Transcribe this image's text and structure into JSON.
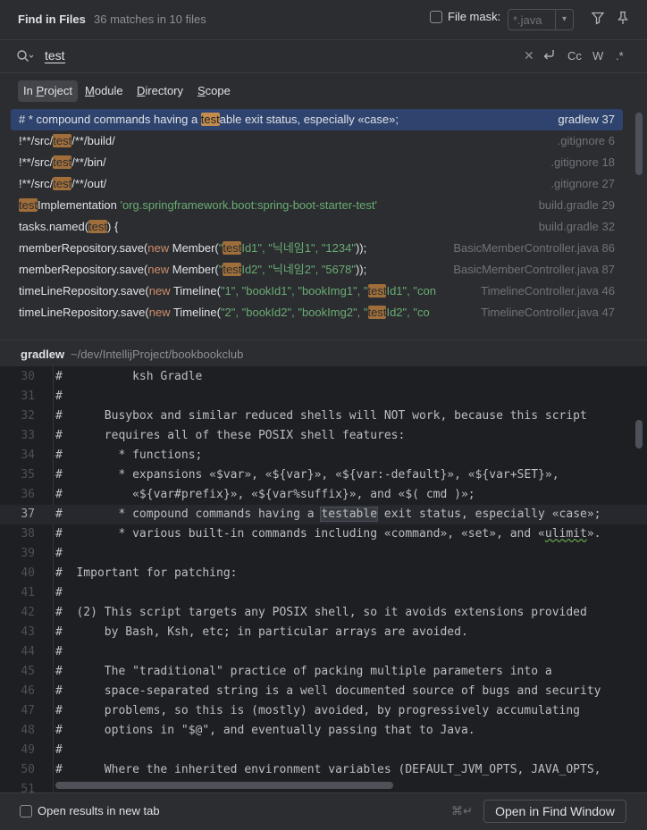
{
  "header": {
    "title": "Find in Files",
    "match_count": "36 matches in 10 files",
    "file_mask_label": "File mask:",
    "file_mask_value": "*.java"
  },
  "search": {
    "query": "test",
    "options": [
      "Cc",
      "W",
      ".*"
    ]
  },
  "scope": {
    "tabs": [
      {
        "prefix": "In ",
        "underline": "P",
        "rest": "roject",
        "active": true
      },
      {
        "prefix": "",
        "underline": "M",
        "rest": "odule"
      },
      {
        "prefix": "",
        "underline": "D",
        "rest": "irectory"
      },
      {
        "prefix": "",
        "underline": "S",
        "rest": "cope"
      }
    ]
  },
  "results": [
    {
      "pre": "#        * compound commands having a ",
      "match": "test",
      "post": "able exit status, especially «case»;",
      "file": "gradlew",
      "line": "37",
      "selected": true
    },
    {
      "pre": "!**/src/",
      "match": "test",
      "post": "/**/build/",
      "file": ".gitignore",
      "line": "6"
    },
    {
      "pre": "!**/src/",
      "match": "test",
      "post": "/**/bin/",
      "file": ".gitignore",
      "line": "18"
    },
    {
      "pre": "!**/src/",
      "match": "test",
      "post": "/**/out/",
      "file": ".gitignore",
      "line": "27"
    },
    {
      "pre": "",
      "match": "test",
      "post": "Implementation ",
      "str": "'org.springframework.boot:spring-boot-starter-test'",
      "file": "build.gradle",
      "line": "29"
    },
    {
      "pre": "tasks.named(",
      "match": "test",
      "post": ") {",
      "file": "build.gradle",
      "line": "32"
    },
    {
      "pre": "memberRepository.save(",
      "kw": "new",
      "pre2": " Member(",
      "strpre": "\"",
      "match": "test",
      "strpost": "Id1\", \"닉네임1\", \"1234\"",
      "post": "));",
      "file": "BasicMemberController.java",
      "line": "86"
    },
    {
      "pre": "memberRepository.save(",
      "kw": "new",
      "pre2": " Member(",
      "strpre": "\"",
      "match": "test",
      "strpost": "Id2\", \"닉네임2\", \"5678\"",
      "post": "));",
      "file": "BasicMemberController.java",
      "line": "87"
    },
    {
      "pre": "timeLineRepository.save(",
      "kw": "new",
      "pre2": " Timeline(",
      "strpre": "\"1\", \"bookId1\", \"bookImg1\", \"",
      "match": "test",
      "strpost": "Id1\", \"con",
      "post": "",
      "file": "TimelineController.java",
      "line": "46"
    },
    {
      "pre": "timeLineRepository.save(",
      "kw": "new",
      "pre2": " Timeline(",
      "strpre": "\"2\", \"bookId2\", \"bookImg2\", \"",
      "match": "test",
      "strpost": "Id2\", \"co",
      "post": "",
      "file": "TimelineController.java",
      "line": "47"
    }
  ],
  "preview": {
    "file": "gradlew",
    "path": "~/dev/IntellijProject/bookbookclub",
    "lines": [
      {
        "n": "30",
        "t": "#          ksh Gradle"
      },
      {
        "n": "31",
        "t": "#"
      },
      {
        "n": "32",
        "t": "#      Busybox and similar reduced shells will NOT work, because this script"
      },
      {
        "n": "33",
        "t": "#      requires all of these POSIX shell features:"
      },
      {
        "n": "34",
        "t": "#        * functions;"
      },
      {
        "n": "35",
        "t": "#        * expansions «$var», «${var}», «${var:-default}», «${var+SET}»,"
      },
      {
        "n": "36",
        "t": "#          «${var#prefix}», «${var%suffix}», and «$( cmd )»;"
      },
      {
        "n": "37",
        "pre": "#        * compound commands having a ",
        "match": "testable",
        "post": " exit status, especially «case»;",
        "current": true
      },
      {
        "n": "38",
        "pre": "#        * various built-in commands including «command», «set», and «",
        "squig": "ulimit",
        "post": "»."
      },
      {
        "n": "39",
        "t": "#"
      },
      {
        "n": "40",
        "t": "#  Important for patching:"
      },
      {
        "n": "41",
        "t": "#"
      },
      {
        "n": "42",
        "t": "#  (2) This script targets any POSIX shell, so it avoids extensions provided"
      },
      {
        "n": "43",
        "t": "#      by Bash, Ksh, etc; in particular arrays are avoided."
      },
      {
        "n": "44",
        "t": "#"
      },
      {
        "n": "45",
        "t": "#      The \"traditional\" practice of packing multiple parameters into a"
      },
      {
        "n": "46",
        "t": "#      space-separated string is a well documented source of bugs and security"
      },
      {
        "n": "47",
        "t": "#      problems, so this is (mostly) avoided, by progressively accumulating"
      },
      {
        "n": "48",
        "t": "#      options in \"$@\", and eventually passing that to Java."
      },
      {
        "n": "49",
        "t": "#"
      },
      {
        "n": "50",
        "t": "#      Where the inherited environment variables (DEFAULT_JVM_OPTS, JAVA_OPTS,"
      },
      {
        "n": "51",
        "t": ""
      }
    ]
  },
  "footer": {
    "open_in_new_tab": "Open results in new tab",
    "shortcut": "⌘↵",
    "open_button": "Open in Find Window"
  }
}
